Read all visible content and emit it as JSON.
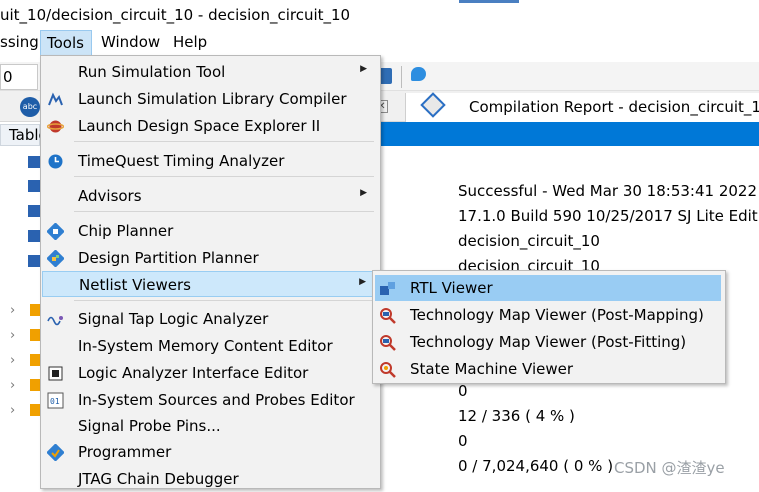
{
  "window": {
    "title": "uit_10/decision_circuit_10 - decision_circuit_10"
  },
  "menubar": {
    "items": [
      {
        "id": "processing",
        "label": "ssing"
      },
      {
        "id": "tools",
        "label": "Tools"
      },
      {
        "id": "window",
        "label": "Window"
      },
      {
        "id": "help",
        "label": "Help"
      }
    ]
  },
  "toolbar": {
    "left_value": "0"
  },
  "tabs": {
    "report_tab_label": "Compilation Report - decision_circuit_10"
  },
  "left_panel": {
    "table_header": "Table"
  },
  "tools_menu": {
    "items": [
      {
        "label": "Run Simulation Tool",
        "has_submenu": true,
        "icon": ""
      },
      {
        "label": "Launch Simulation Library Compiler",
        "has_submenu": false,
        "icon": "simulation-library-icon"
      },
      {
        "label": "Launch Design Space Explorer II",
        "has_submenu": false,
        "icon": "design-space-explorer-icon"
      },
      {
        "label": "TimeQuest Timing Analyzer",
        "has_submenu": false,
        "icon": "timequest-clock-icon"
      },
      {
        "label": "Advisors",
        "has_submenu": true,
        "icon": ""
      },
      {
        "label": "Chip Planner",
        "has_submenu": false,
        "icon": "chip-planner-icon"
      },
      {
        "label": "Design Partition Planner",
        "has_submenu": false,
        "icon": "partition-planner-icon"
      },
      {
        "label": "Netlist Viewers",
        "has_submenu": true,
        "icon": "",
        "highlighted": true
      },
      {
        "label": "Signal Tap Logic Analyzer",
        "has_submenu": false,
        "icon": "signal-tap-icon"
      },
      {
        "label": "In-System Memory Content Editor",
        "has_submenu": false,
        "icon": ""
      },
      {
        "label": "Logic Analyzer Interface Editor",
        "has_submenu": false,
        "icon": "logic-analyzer-interface-icon"
      },
      {
        "label": "In-System Sources and Probes Editor",
        "has_submenu": false,
        "icon": "sources-probes-icon"
      },
      {
        "label": "Signal Probe Pins...",
        "has_submenu": false,
        "icon": ""
      },
      {
        "label": "Programmer",
        "has_submenu": false,
        "icon": "programmer-icon"
      },
      {
        "label": "JTAG Chain Debugger",
        "has_submenu": false,
        "icon": ""
      }
    ]
  },
  "netlist_submenu": {
    "items": [
      {
        "label": "RTL Viewer",
        "icon": "rtl-viewer-icon",
        "highlighted": true
      },
      {
        "label": "Technology Map Viewer (Post-Mapping)",
        "icon": "tech-map-post-mapping-icon"
      },
      {
        "label": "Technology Map Viewer (Post-Fitting)",
        "icon": "tech-map-post-fitting-icon"
      },
      {
        "label": "State Machine Viewer",
        "icon": "state-machine-viewer-icon"
      }
    ]
  },
  "report_values": [
    "Successful - Wed Mar 30 18:53:41 2022",
    "17.1.0 Build 590 10/25/2017 SJ Lite Edition",
    "decision_circuit_10",
    "decision_circuit_10",
    "0",
    "12 / 336 ( 4 % )",
    "0",
    "0 / 7,024,640 ( 0 % )"
  ],
  "watermark": {
    "text": "CSDN @渣渣ye"
  },
  "colors": {
    "accent_blue": "#0078d7",
    "menu_highlight": "#cde8fb",
    "submenu_highlight": "#99ccf3"
  }
}
